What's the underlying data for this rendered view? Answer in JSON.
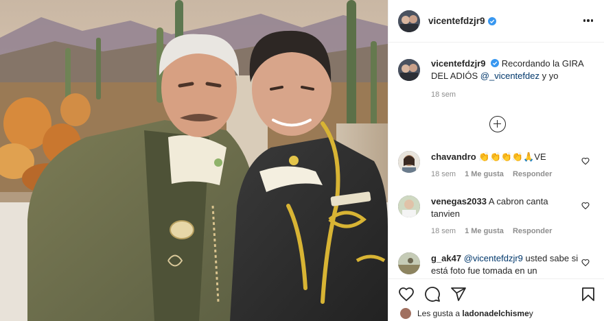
{
  "post": {
    "username": "vicentefdzjr9",
    "verified": true,
    "caption_prefix": "Recordando la GIRA DEL ADIÓS ",
    "caption_mention": "@_vicentefdez",
    "caption_suffix": " y yo",
    "caption_time": "18 sem"
  },
  "comments": [
    {
      "username": "chavandro",
      "text": "👏👏👏👏🙏VE",
      "time": "18 sem",
      "likes": "1 Me gusta",
      "reply": "Responder"
    },
    {
      "username": "venegas2033",
      "text": "A cabron canta tanvien",
      "time": "18 sem",
      "likes": "1 Me gusta",
      "reply": "Responder"
    },
    {
      "username": "g_ak47",
      "mention": "@vicentefdzjr9",
      "text": " usted sabe si está foto fue tomada en un"
    }
  ],
  "likes_bar": {
    "prefix": "Les gusta a ",
    "user": "ladonadelchisme",
    "suffix": " y"
  },
  "colors": {
    "mention": "#00376b",
    "verified": "#3897f0",
    "muted": "#8e8e8e"
  },
  "icons": [
    "more-options-icon",
    "verified-badge-icon",
    "load-more-icon",
    "heart-icon",
    "comment-icon",
    "share-icon",
    "bookmark-icon"
  ]
}
